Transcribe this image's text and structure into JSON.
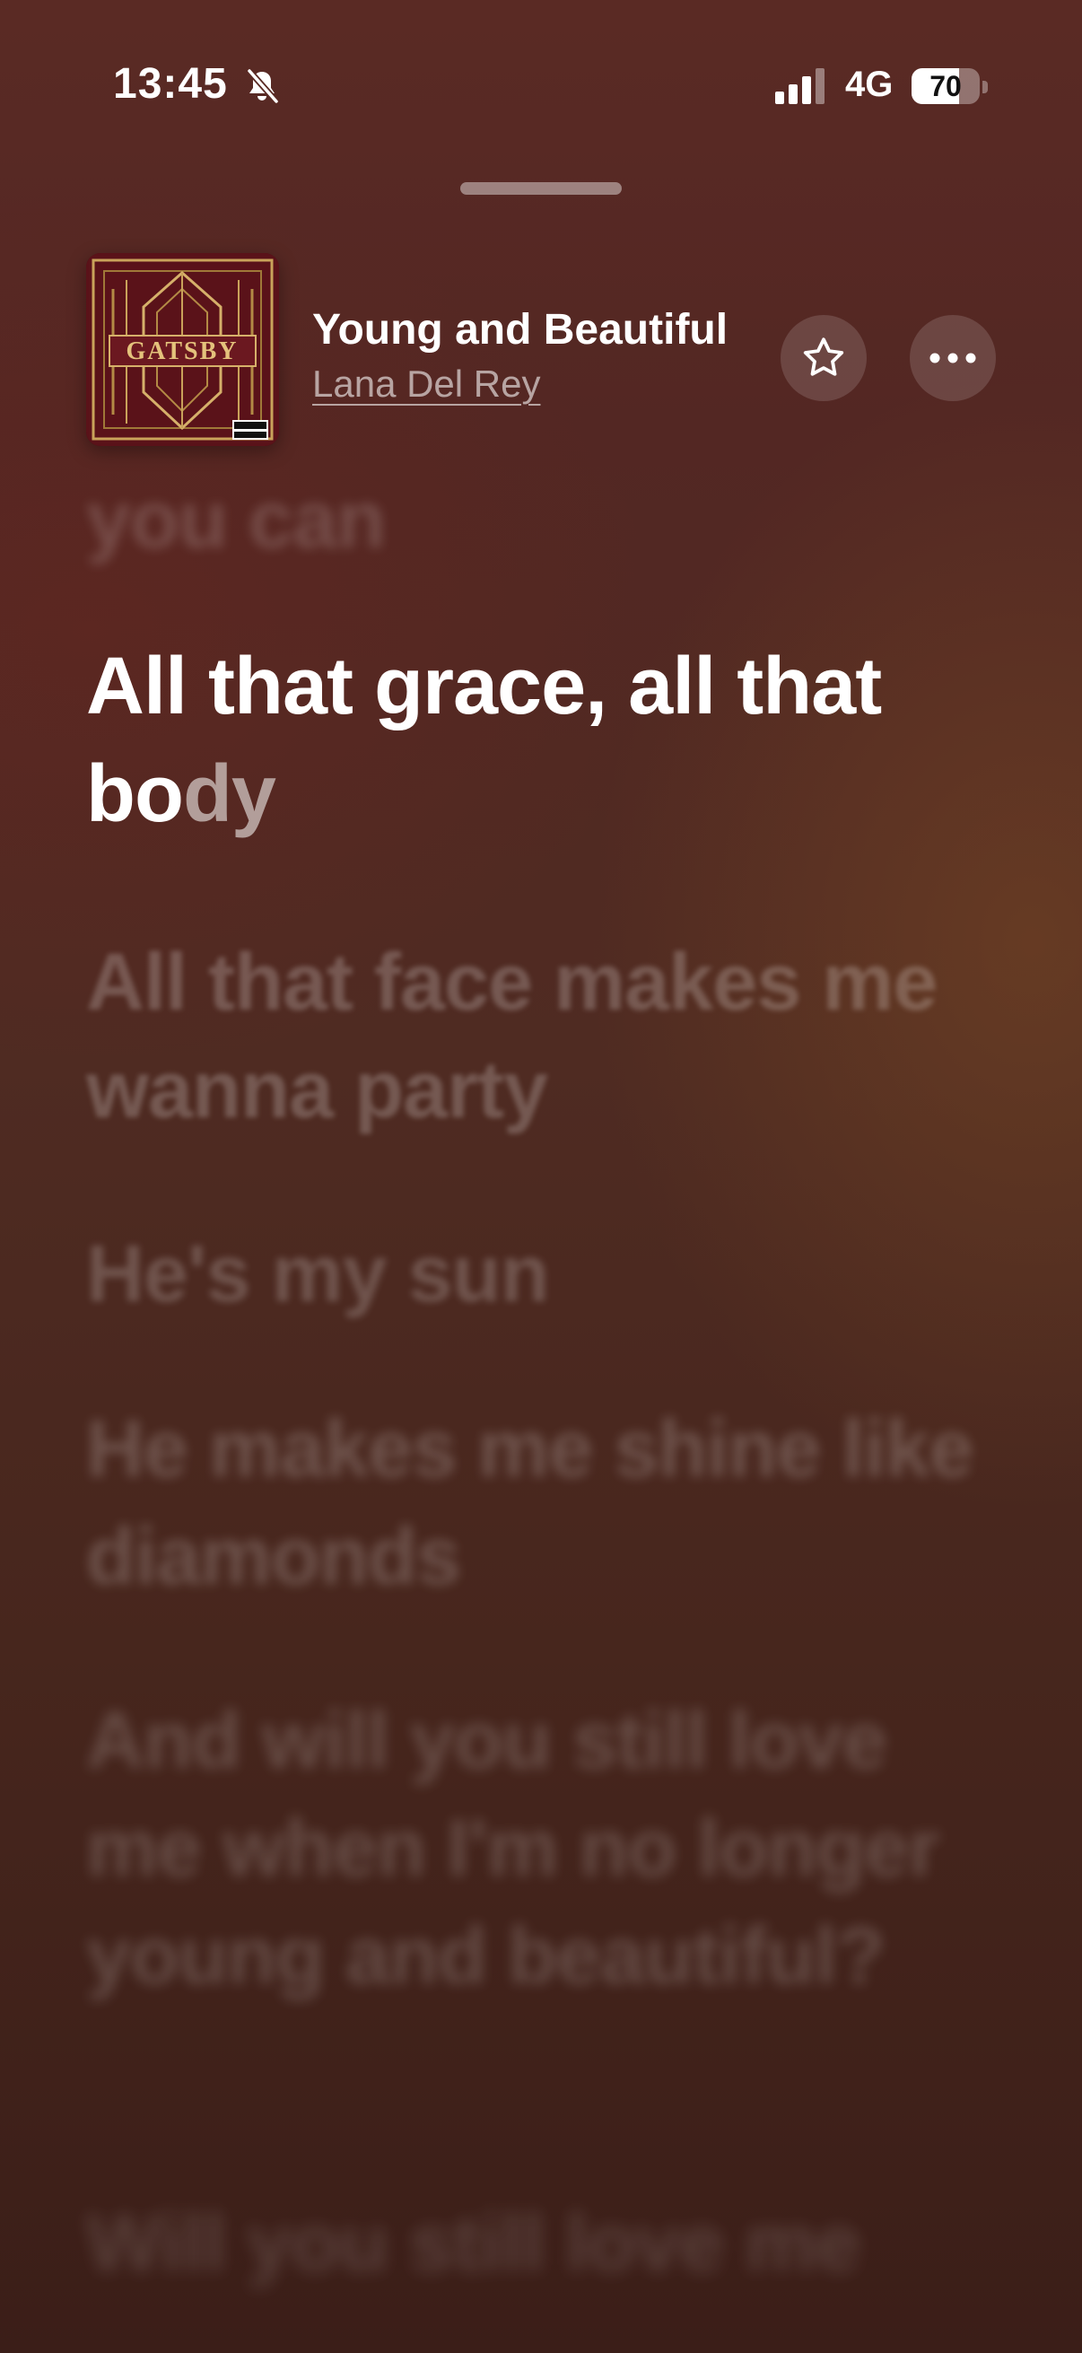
{
  "status_bar": {
    "time": "13:45",
    "network": "4G",
    "battery_percent": "70",
    "battery_level": 0.7,
    "icons": [
      "bell-slash-icon",
      "cellular-signal-icon",
      "battery-icon"
    ]
  },
  "now_playing": {
    "title": "Young and Beautiful",
    "artist": "Lana Del Rey",
    "artwork_text": "GATSBY",
    "favorite_icon": "star-icon",
    "more_icon": "ellipsis-icon"
  },
  "lyrics": {
    "previous": "you can",
    "current_sung": "All that grace, all that bo",
    "current_unsung": "dy",
    "upcoming": [
      "All that face makes me wanna party",
      "He's my sun",
      "He makes me shine like diamonds",
      "And will you still love me when I'm no longer young and beautiful?",
      "Will you still love me"
    ]
  },
  "colors": {
    "background_top": "#5a2a24",
    "background_bottom": "#3b1e18",
    "text": "#ffffff"
  }
}
